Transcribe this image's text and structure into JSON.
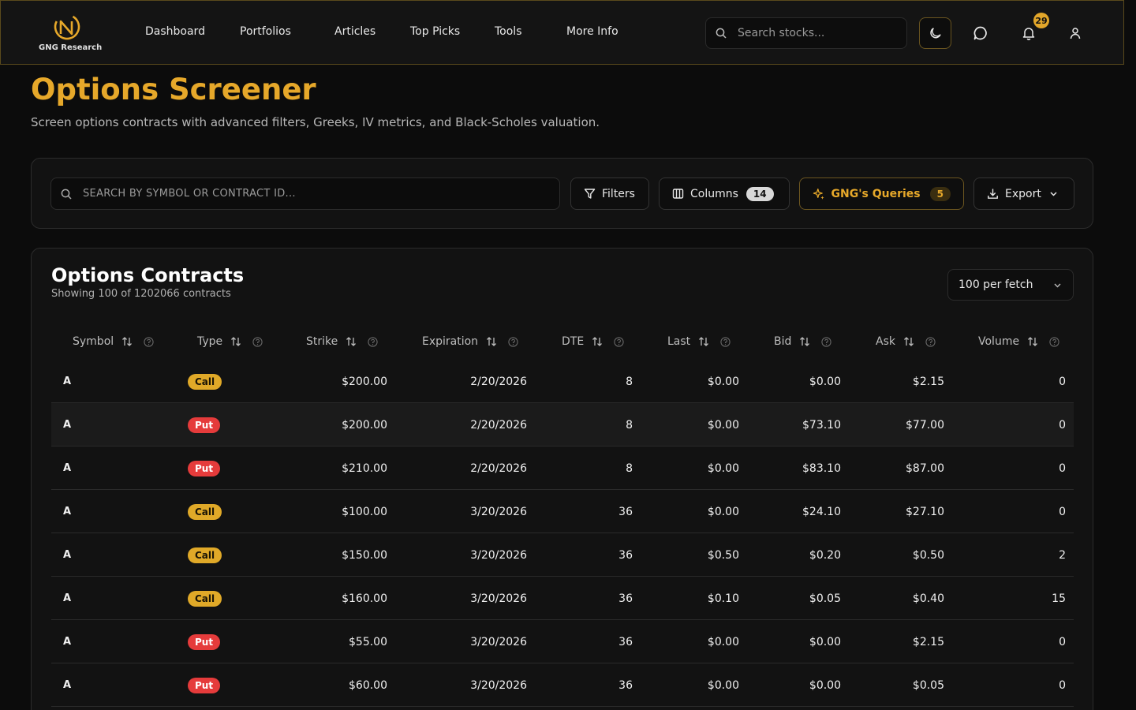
{
  "nav": {
    "brand": "GNG Research",
    "links": [
      "Dashboard",
      "Portfolios",
      "Articles",
      "Top Picks",
      "Tools",
      "More Info"
    ],
    "search_placeholder": "Search stocks...",
    "notification_count": "29"
  },
  "header": {
    "title": "Options Screener",
    "subtitle": "Screen options contracts with advanced filters, Greeks, IV metrics, and Black-Scholes valuation."
  },
  "toolbar": {
    "search_placeholder": "SEARCH BY SYMBOL OR CONTRACT ID...",
    "filters_label": "Filters",
    "columns_label": "Columns",
    "columns_count": "14",
    "queries_label": "GNG's Queries",
    "queries_count": "5",
    "export_label": "Export"
  },
  "table": {
    "title": "Options Contracts",
    "subtitle": "Showing 100 of 1202066 contracts",
    "fetch_label": "100 per fetch",
    "columns": [
      "Symbol",
      "Type",
      "Strike",
      "Expiration",
      "DTE",
      "Last",
      "Bid",
      "Ask",
      "Volume"
    ],
    "rows": [
      {
        "symbol": "A",
        "type": "Call",
        "strike": "$200.00",
        "expiration": "2/20/2026",
        "dte": "8",
        "last": "$0.00",
        "bid": "$0.00",
        "ask": "$2.15",
        "volume": "0"
      },
      {
        "symbol": "A",
        "type": "Put",
        "strike": "$200.00",
        "expiration": "2/20/2026",
        "dte": "8",
        "last": "$0.00",
        "bid": "$73.10",
        "ask": "$77.00",
        "volume": "0"
      },
      {
        "symbol": "A",
        "type": "Put",
        "strike": "$210.00",
        "expiration": "2/20/2026",
        "dte": "8",
        "last": "$0.00",
        "bid": "$83.10",
        "ask": "$87.00",
        "volume": "0"
      },
      {
        "symbol": "A",
        "type": "Call",
        "strike": "$100.00",
        "expiration": "3/20/2026",
        "dte": "36",
        "last": "$0.00",
        "bid": "$24.10",
        "ask": "$27.10",
        "volume": "0"
      },
      {
        "symbol": "A",
        "type": "Call",
        "strike": "$150.00",
        "expiration": "3/20/2026",
        "dte": "36",
        "last": "$0.50",
        "bid": "$0.20",
        "ask": "$0.50",
        "volume": "2"
      },
      {
        "symbol": "A",
        "type": "Call",
        "strike": "$160.00",
        "expiration": "3/20/2026",
        "dte": "36",
        "last": "$0.10",
        "bid": "$0.05",
        "ask": "$0.40",
        "volume": "15"
      },
      {
        "symbol": "A",
        "type": "Put",
        "strike": "$55.00",
        "expiration": "3/20/2026",
        "dte": "36",
        "last": "$0.00",
        "bid": "$0.00",
        "ask": "$2.15",
        "volume": "0"
      },
      {
        "symbol": "A",
        "type": "Put",
        "strike": "$60.00",
        "expiration": "3/20/2026",
        "dte": "36",
        "last": "$0.00",
        "bid": "$0.00",
        "ask": "$0.05",
        "volume": "0"
      }
    ]
  },
  "colors": {
    "accent": "#e6a82a",
    "call": "#e0a928",
    "put": "#e53b3b",
    "background": "#0c0c0c"
  }
}
